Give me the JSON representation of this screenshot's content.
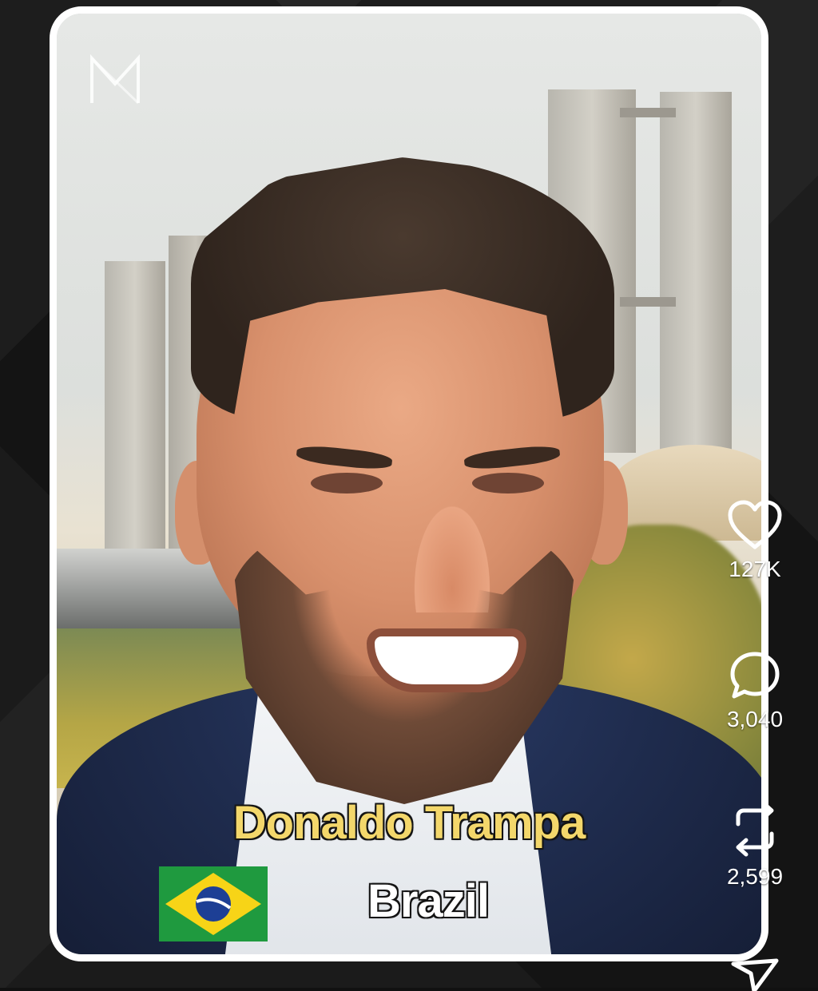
{
  "video": {
    "caption_name": "Donaldo Trampa",
    "caption_country": "Brazil",
    "logo_icon": "m-logo-icon",
    "flag_icon": "brazil-flag-icon"
  },
  "actions": {
    "like": {
      "icon": "heart-icon",
      "count": "127K"
    },
    "comment": {
      "icon": "comment-icon",
      "count": "3,040"
    },
    "repost": {
      "icon": "repost-icon",
      "count": "2,599"
    },
    "share": {
      "icon": "send-icon"
    }
  },
  "colors": {
    "caption_name": "#f3d76b",
    "caption_country": "#ffffff",
    "background": "#141414",
    "card_border": "#ffffff"
  }
}
